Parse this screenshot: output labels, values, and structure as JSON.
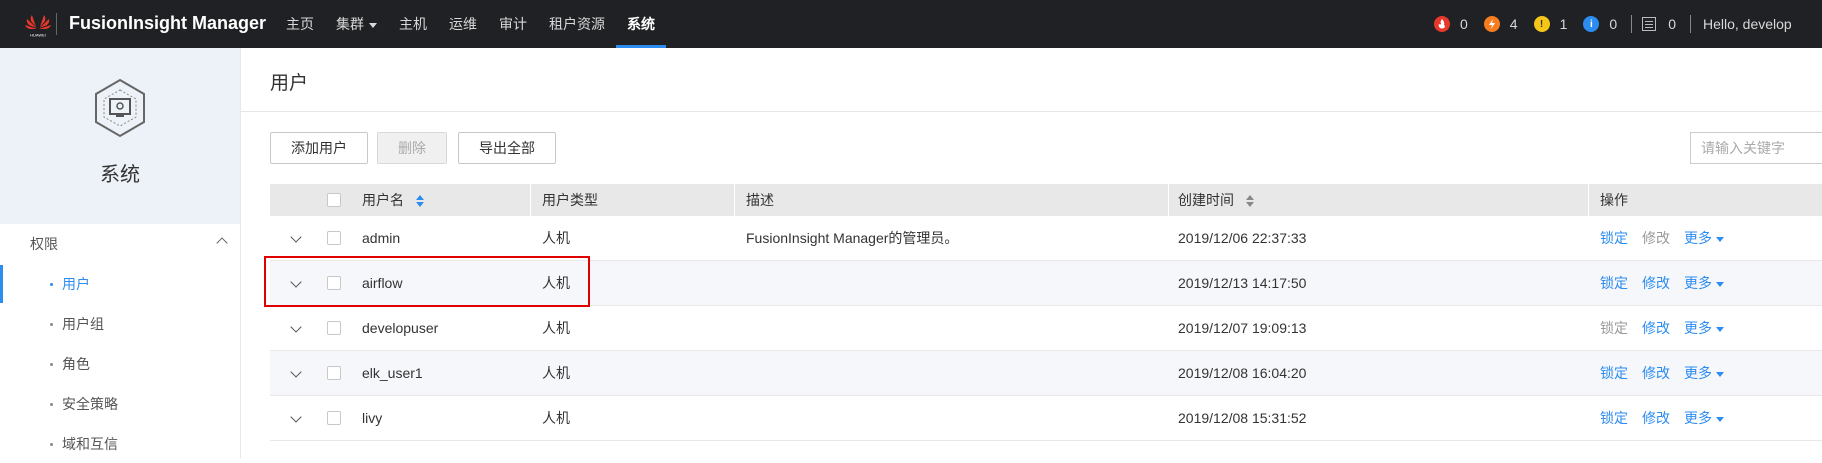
{
  "topbar": {
    "logo_text": "HUAWEI",
    "brand": "FusionInsight Manager",
    "nav": [
      {
        "label": "主页",
        "active": false,
        "dropdown": false
      },
      {
        "label": "集群",
        "active": false,
        "dropdown": true
      },
      {
        "label": "主机",
        "active": false,
        "dropdown": false
      },
      {
        "label": "运维",
        "active": false,
        "dropdown": false
      },
      {
        "label": "审计",
        "active": false,
        "dropdown": false
      },
      {
        "label": "租户资源",
        "active": false,
        "dropdown": false
      },
      {
        "label": "系统",
        "active": true,
        "dropdown": false
      }
    ],
    "alarms": [
      {
        "name": "critical",
        "count": "0",
        "color": "#e8382c",
        "icon": "flame-icon"
      },
      {
        "name": "major",
        "count": "4",
        "color": "#f57c1f",
        "icon": "bolt-icon"
      },
      {
        "name": "minor",
        "count": "1",
        "color": "#f5c518",
        "icon": "exclamation-icon"
      },
      {
        "name": "info",
        "count": "0",
        "color": "#2d8cf0",
        "icon": "info-icon"
      }
    ],
    "tasks_count": "0",
    "hello": "Hello, develop"
  },
  "sidebar": {
    "title": "系统",
    "group": "权限",
    "items": [
      {
        "label": "用户",
        "active": true
      },
      {
        "label": "用户组",
        "active": false
      },
      {
        "label": "角色",
        "active": false
      },
      {
        "label": "安全策略",
        "active": false
      },
      {
        "label": "域和互信",
        "active": false
      }
    ]
  },
  "main": {
    "title": "用户",
    "buttons": {
      "add": "添加用户",
      "delete": "删除",
      "export": "导出全部"
    },
    "search_placeholder": "请输入关键字",
    "columns": {
      "name": "用户名",
      "type": "用户类型",
      "desc": "描述",
      "created": "创建时间",
      "ops": "操作"
    },
    "rows": [
      {
        "name": "admin",
        "type": "人机",
        "desc": "FusionInsight Manager的管理员。",
        "created": "2019/12/06 22:37:33",
        "lock": "锁定",
        "modify": "修改",
        "more": "更多",
        "lock_enabled": true,
        "modify_enabled": false
      },
      {
        "name": "airflow",
        "type": "人机",
        "desc": "",
        "created": "2019/12/13 14:17:50",
        "lock": "锁定",
        "modify": "修改",
        "more": "更多",
        "lock_enabled": true,
        "modify_enabled": true
      },
      {
        "name": "developuser",
        "type": "人机",
        "desc": "",
        "created": "2019/12/07 19:09:13",
        "lock": "锁定",
        "modify": "修改",
        "more": "更多",
        "lock_enabled": false,
        "modify_enabled": true
      },
      {
        "name": "elk_user1",
        "type": "人机",
        "desc": "",
        "created": "2019/12/08 16:04:20",
        "lock": "锁定",
        "modify": "修改",
        "more": "更多",
        "lock_enabled": true,
        "modify_enabled": true
      },
      {
        "name": "livy",
        "type": "人机",
        "desc": "",
        "created": "2019/12/08 15:31:52",
        "lock": "锁定",
        "modify": "修改",
        "more": "更多",
        "lock_enabled": true,
        "modify_enabled": true
      }
    ]
  },
  "colors": {
    "accent": "#2d8cf0",
    "topbar": "#202124",
    "highlight": "#e00000"
  }
}
